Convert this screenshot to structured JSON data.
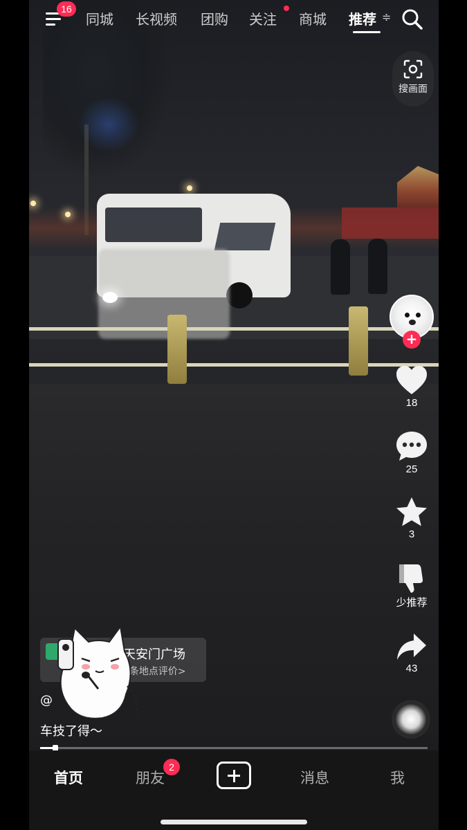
{
  "top_nav": {
    "menu_badge": "16",
    "tabs": [
      {
        "label": "同城"
      },
      {
        "label": "长视频"
      },
      {
        "label": "团购"
      },
      {
        "label": "关注"
      },
      {
        "label": "商城"
      },
      {
        "label": "推荐",
        "active": true
      }
    ],
    "more_glyph": "≑",
    "search_icon": "search-icon"
  },
  "scan": {
    "label": "搜画面",
    "icon": "scan-icon"
  },
  "rail": {
    "like_count": "18",
    "comment_count": "25",
    "favorite_count": "3",
    "dislike_label": "少推荐",
    "share_count": "43"
  },
  "video_info": {
    "location_title": "天安门广场",
    "location_sub": "4条地点评价>",
    "author": "@",
    "caption": "车技了得～"
  },
  "progress": {
    "value_fraction": 0.04
  },
  "bottom_nav": {
    "items": [
      {
        "label": "首页",
        "active": true
      },
      {
        "label": "朋友"
      },
      {
        "label": "消息"
      },
      {
        "label": "我"
      }
    ],
    "friend_badge": "2"
  },
  "colors": {
    "accent": "#fe2c55",
    "nav_bg": "#161616"
  }
}
